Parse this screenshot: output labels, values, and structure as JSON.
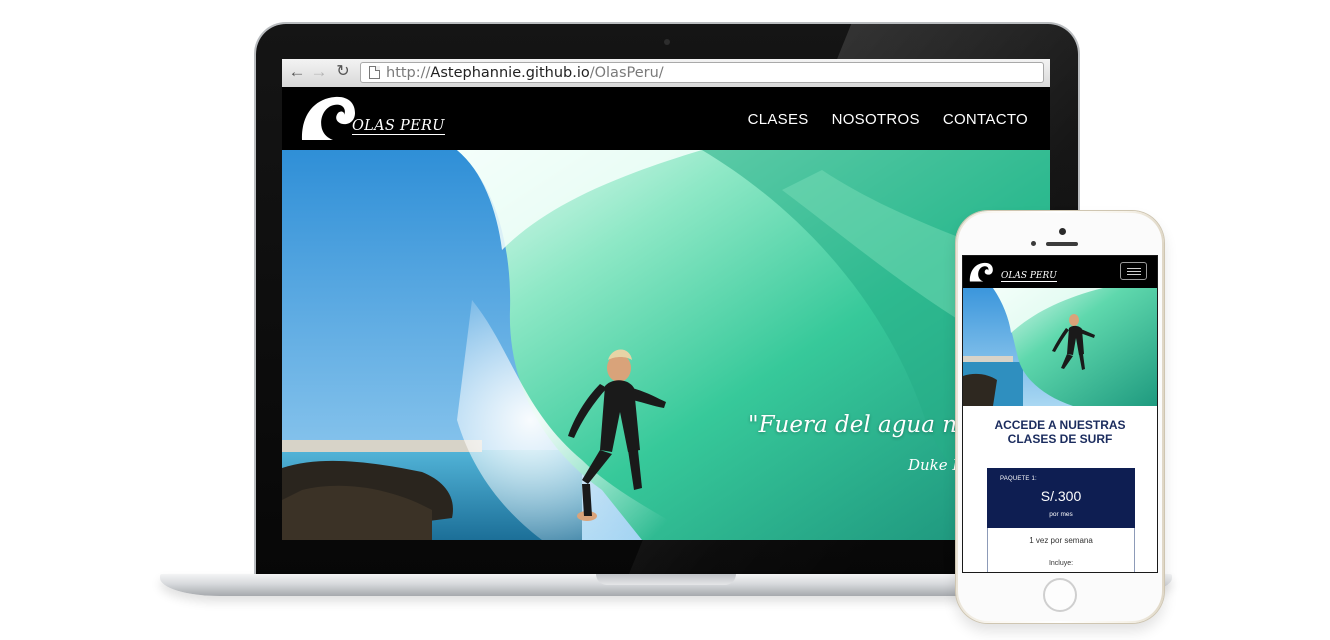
{
  "browser": {
    "back_icon": "arrow-left-icon",
    "forward_icon": "arrow-right-icon",
    "reload_icon": "reload-icon",
    "url_prefix": "http://",
    "url_host": "Astephannie.github.io",
    "url_path": "/OlasPeru/"
  },
  "site": {
    "logo_text": "OLAS PERU",
    "nav": [
      "CLASES",
      "NOSOTROS",
      "CONTACTO"
    ],
    "hero_quote": "\"Fuera del agua no soy",
    "hero_author": "Duke Ka"
  },
  "mobile": {
    "logo_text": "OLAS PERU",
    "menu_icon": "hamburger-menu-icon",
    "title_line1": "ACCEDE A NUESTRAS",
    "title_line2": "CLASES DE SURF",
    "package": {
      "label": "PAQUETE 1:",
      "price": "S/.300",
      "period": "por mes",
      "frequency": "1 vez por semana",
      "includes": "Incluye:"
    }
  },
  "colors": {
    "nav_background": "#000000",
    "package_background": "#0e1e52",
    "title_color": "#1b2c5e",
    "wave_green": "#3fd39a",
    "sky_blue": "#4aa7e2"
  }
}
